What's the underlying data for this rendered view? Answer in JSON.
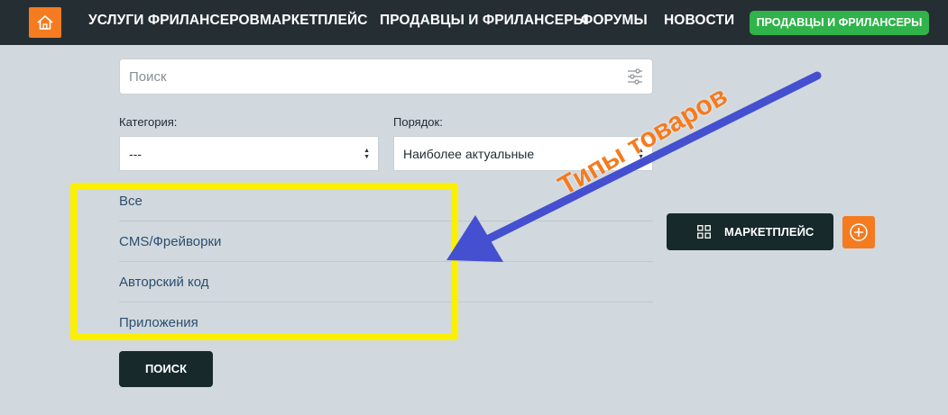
{
  "topbar": {
    "home_icon": "home-icon",
    "nav": [
      {
        "label": "УСЛУГИ ФРИЛАНСЕРОВ"
      },
      {
        "label": "МАРКЕТПЛЕЙС"
      },
      {
        "label": "ПРОДАВЦЫ И ФРИЛАНСЕРЫ"
      },
      {
        "label": "ФОРУМЫ"
      },
      {
        "label": "НОВОСТИ"
      }
    ],
    "cta_label": "ПРОДАВЦЫ И ФРИЛАНСЕРЫ",
    "cta_color": "#2fb34a"
  },
  "search": {
    "placeholder": "Поиск",
    "value": "",
    "filter_icon": "sliders-icon"
  },
  "filters": {
    "category": {
      "label": "Категория:",
      "selected": "---"
    },
    "order": {
      "label": "Порядок:",
      "selected": "Наиболее актуальные"
    }
  },
  "categories": [
    {
      "label": "Все"
    },
    {
      "label": "CMS/Фрейворки"
    },
    {
      "label": "Авторский код"
    },
    {
      "label": "Приложения"
    }
  ],
  "search_button_label": "ПОИСК",
  "marketplace_button": {
    "label": "МАРКЕТПЛЕЙС",
    "icon": "grid-icon"
  },
  "add_button_icon": "plus-circle-icon",
  "annotation": {
    "text": "Типы товаров",
    "text_color": "#f47b20",
    "arrow_color": "#4450d0",
    "highlight_color": "#fbf000"
  },
  "colors": {
    "accent_orange": "#f47b20",
    "dark_bar": "#252e33",
    "dark_button": "#17292a",
    "background": "#d1d9df",
    "link_blue": "#2d4e6d"
  }
}
